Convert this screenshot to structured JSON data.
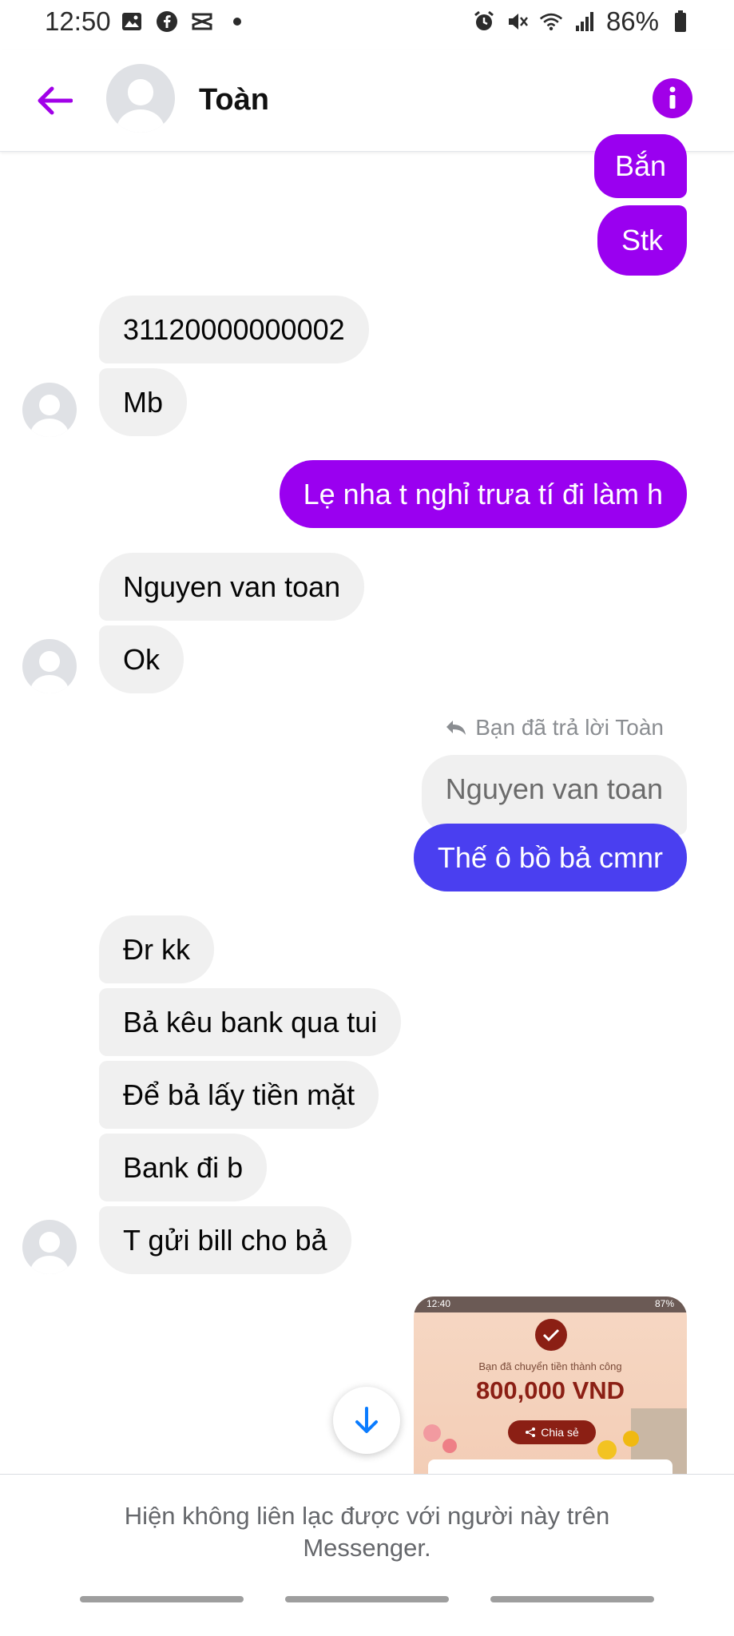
{
  "status_bar": {
    "time": "12:50",
    "battery": "86%",
    "left_icons": [
      "image-icon",
      "facebook-icon",
      "capcut-icon",
      "dot-icon"
    ],
    "right_icons": [
      "alarm-icon",
      "mute-icon",
      "wifi-icon",
      "signal-icon",
      "battery-icon"
    ]
  },
  "header": {
    "contact_name": "Toàn",
    "accent_color": "#a100e8"
  },
  "messages": [
    {
      "from": "me",
      "text": "Bắn"
    },
    {
      "from": "me",
      "text": "Stk"
    },
    {
      "from": "them",
      "text": "31120000000002"
    },
    {
      "from": "them",
      "text": "Mb"
    },
    {
      "from": "me",
      "text": "Lẹ nha t nghỉ trưa tí đi làm h"
    },
    {
      "from": "them",
      "text": "Nguyen van toan"
    },
    {
      "from": "them",
      "text": "Ok"
    },
    {
      "from": "me",
      "reply_note": "Bạn đã trả lời Toàn",
      "quoted": "Nguyen van toan",
      "text": "Thế ô bồ bả cmnr"
    },
    {
      "from": "them",
      "text": "Đr kk"
    },
    {
      "from": "them",
      "text": "Bả kêu bank qua tui"
    },
    {
      "from": "them",
      "text": "Để bả lấy tiền mặt"
    },
    {
      "from": "them",
      "text": "Bank đi b"
    },
    {
      "from": "them",
      "text": "T gửi bill cho bả"
    }
  ],
  "attachment": {
    "status_time": "12:40",
    "status_battery": "87%",
    "caption": "Bạn đã chuyển tiền thành công",
    "amount": "800,000 VND",
    "share_label": "Chia sẻ"
  },
  "footer": {
    "notice": "Hiện không liên lạc được với người này trên Messenger."
  },
  "colors": {
    "outgoing": "#9a00f0",
    "outgoing_reply": "#4a3ff0",
    "incoming": "#f0f0f0"
  }
}
